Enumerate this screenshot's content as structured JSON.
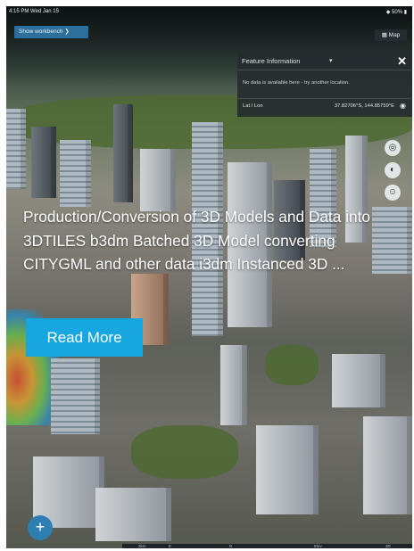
{
  "status_bar": {
    "time": "4:15 PM  Wed Jan 15",
    "right": "◆ 50% ▮"
  },
  "toolbar": {
    "workbench_label": "Show workbench",
    "workbench_chevron": "❯",
    "map_label": "Map",
    "map_icon": "map-icon"
  },
  "feature_panel": {
    "title": "Feature Information",
    "chevron": "▾",
    "close": "✕",
    "message": "No data is available here - try another location.",
    "lat_lon_label": "Lat / Lon",
    "lat_lon_value": "37.82706°S, 144.85759°E",
    "pin_icon": "location-pin-icon"
  },
  "nav_controls": [
    {
      "name": "compass-icon",
      "glyph": "◎"
    },
    {
      "name": "zoom-icon",
      "glyph": "◐"
    },
    {
      "name": "people-icon",
      "glyph": "☺"
    }
  ],
  "overlay": {
    "description": "Production/Conversion of 3D Models and Data into 3DTILES  b3dm Batched 3D Model converting CITYGML and other data i3dm Instanced 3D ...",
    "read_more_label": "Read More"
  },
  "fab": {
    "label": "+"
  },
  "bottom_bar": {
    "items": [
      "2km",
      "E",
      "N",
      "Elev",
      "3D"
    ]
  },
  "colors": {
    "read_more_bg": "#17a7e0",
    "workbench_bg": "#2c6f9c",
    "panel_bg": "#262c30",
    "fab_bg": "#2c7fb0"
  }
}
